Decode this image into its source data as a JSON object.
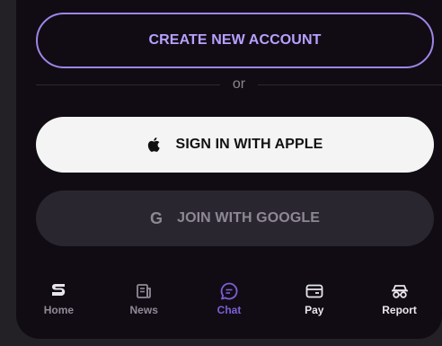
{
  "buttons": {
    "create_account": "CREATE NEW ACCOUNT",
    "apple": "SIGN IN WITH APPLE",
    "google": "JOIN WITH GOOGLE",
    "google_glyph": "G"
  },
  "divider": {
    "label": "or"
  },
  "tabs": [
    {
      "label": "Home",
      "icon": "logo-s-icon",
      "color": "#8f8a96"
    },
    {
      "label": "News",
      "icon": "news-icon",
      "color": "#8f8a96"
    },
    {
      "label": "Chat",
      "icon": "chat-icon",
      "color": "#7d5fd6",
      "active": true
    },
    {
      "label": "Pay",
      "icon": "card-icon",
      "color": "#e8e6ea"
    },
    {
      "label": "Report",
      "icon": "report-icon",
      "color": "#e8e6ea"
    }
  ],
  "colors": {
    "accent": "#b7a1ff",
    "panel": "#110c14",
    "apple_bg": "#f4f4f4",
    "google_bg": "#2a2630"
  }
}
